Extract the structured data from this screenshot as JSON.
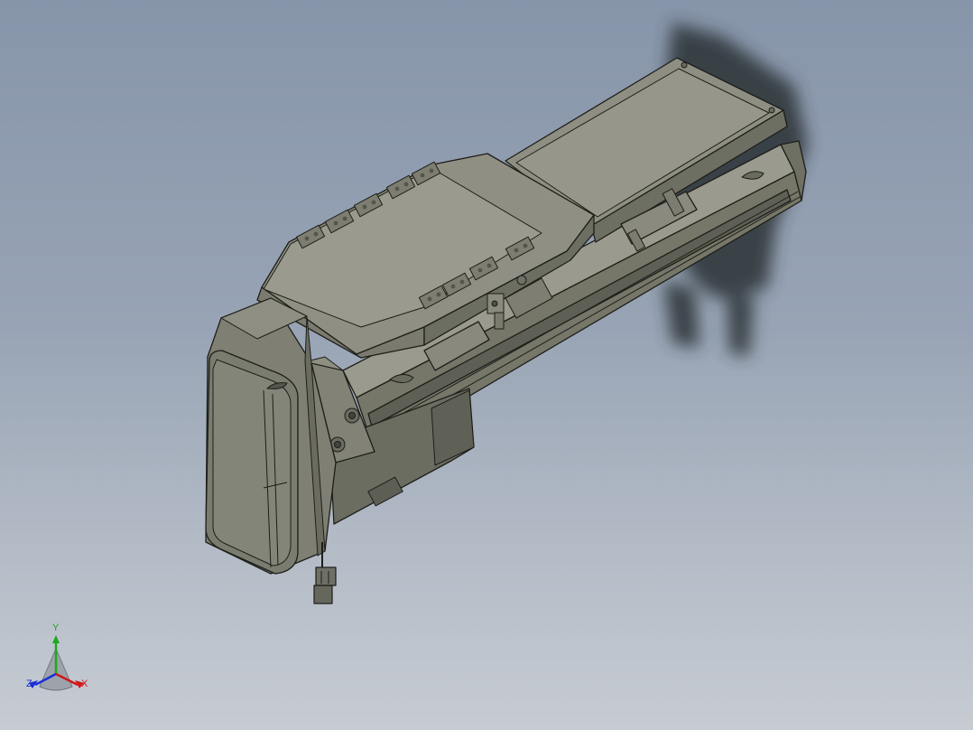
{
  "viewport": {
    "background_top": "#8795aa",
    "background_bottom": "#c7ccd3",
    "model": "linear-actuator-assembly",
    "model_color": "#85867a",
    "edge_color": "#1e1e1a"
  },
  "triad": {
    "x_label": "X",
    "y_label": "Y",
    "z_label": "Z",
    "x_color": "#d01818",
    "y_color": "#1ea81e",
    "z_color": "#1b2fd8"
  }
}
